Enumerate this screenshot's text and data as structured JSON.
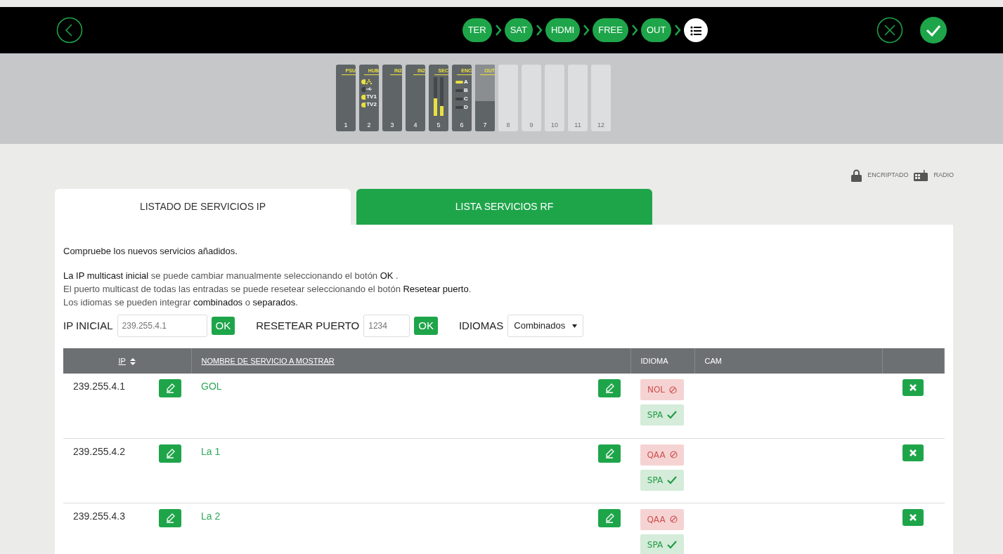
{
  "steps": [
    {
      "kind": "text",
      "label": "TER",
      "selected": false
    },
    {
      "kind": "text",
      "label": "SAT",
      "selected": false
    },
    {
      "kind": "text",
      "label": "HDMI",
      "selected": false
    },
    {
      "kind": "text",
      "label": "FREE",
      "selected": false
    },
    {
      "kind": "text",
      "label": "OUT",
      "selected": false
    },
    {
      "kind": "list",
      "selected": true
    }
  ],
  "slots": [
    {
      "kind": "psu",
      "label": "PSU",
      "number": "1"
    },
    {
      "kind": "hub",
      "label": "HUB",
      "number": "2",
      "ports": [
        {
          "kind": "network",
          "on": true
        },
        {
          "kind": "usb",
          "on": false
        },
        {
          "kind": "tv",
          "label": "TV1",
          "on": true
        },
        {
          "kind": "tv",
          "label": "TV2",
          "on": true
        }
      ]
    },
    {
      "kind": "input",
      "label": "IN2",
      "number": "3"
    },
    {
      "kind": "input",
      "label": "IN2",
      "number": "4"
    },
    {
      "kind": "sec",
      "label": "SEC",
      "number": "5",
      "bars": [
        {
          "level": 0.45
        },
        {
          "level": 0.25
        }
      ]
    },
    {
      "kind": "enc",
      "label": "ENC",
      "number": "6",
      "channels": [
        {
          "label": "A",
          "on": true
        },
        {
          "label": "B",
          "on": false
        },
        {
          "label": "C",
          "on": false
        },
        {
          "label": "D",
          "on": false
        }
      ]
    },
    {
      "kind": "out",
      "label": "OUT",
      "number": "7",
      "level": 0.55
    },
    {
      "kind": "empty",
      "number": "8"
    },
    {
      "kind": "empty",
      "number": "9"
    },
    {
      "kind": "empty",
      "number": "10"
    },
    {
      "kind": "empty",
      "number": "11"
    },
    {
      "kind": "empty",
      "number": "12"
    }
  ],
  "legend": [
    {
      "kind": "lock",
      "label": "ENCRIPTADO"
    },
    {
      "kind": "radio",
      "label": "RADIO"
    }
  ],
  "tabs": [
    {
      "label": "LISTADO DE SERVICIOS IP",
      "selected": true
    },
    {
      "label": "LISTA SERVICIOS RF",
      "selected": false
    }
  ],
  "intro": "Compruebe los nuevos servicios añadidos.",
  "help": [
    "**La IP multicast inicial** se puede cambiar manualmente seleccionando el botón **OK** .",
    "El puerto multicast de todas las entradas se puede resetear seleccionando el botón **Resetear puerto**.",
    "Los idiomas se pueden integrar **combinados** o **separados**."
  ],
  "controls": {
    "ip_label": "IP INICIAL",
    "ip_placeholder": "239.255.4.1",
    "ip_button": "OK",
    "port_label": "RESETEAR PUERTO",
    "port_placeholder": "1234",
    "port_button": "OK",
    "lang_label": "IDIOMAS",
    "lang_value": "Combinados"
  },
  "table": {
    "columns": [
      {
        "label": "IP",
        "sortable": true
      },
      {
        "label": "NOMBRE DE SERVICIO A MOSTRAR",
        "sortable": false
      },
      {
        "label": "IDIOMA",
        "sortable": false
      },
      {
        "label": "CAM",
        "sortable": false
      }
    ],
    "rows": [
      {
        "ip": "239.255.4.1",
        "name": "GOL",
        "languages": [
          {
            "code": "NOL",
            "ok": false
          },
          {
            "code": "SPA",
            "ok": true
          }
        ]
      },
      {
        "ip": "239.255.4.2",
        "name": "La 1",
        "languages": [
          {
            "code": "QAA",
            "ok": false
          },
          {
            "code": "SPA",
            "ok": true
          }
        ]
      },
      {
        "ip": "239.255.4.3",
        "name": "La 2",
        "languages": [
          {
            "code": "QAA",
            "ok": false
          },
          {
            "code": "SPA",
            "ok": true
          }
        ]
      }
    ]
  }
}
